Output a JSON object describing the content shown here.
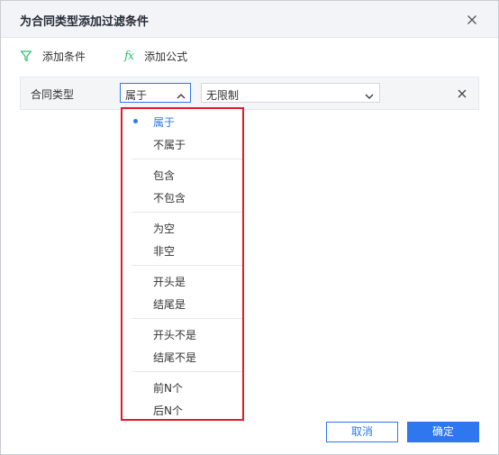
{
  "dialog": {
    "title": "为合同类型添加过滤条件"
  },
  "toolbar": {
    "add_condition": "添加条件",
    "add_formula": "添加公式",
    "formula_icon_text": "fx"
  },
  "condition": {
    "field": "合同类型",
    "operator": "属于",
    "value": "无限制"
  },
  "operator_menu": {
    "groups": [
      [
        "属于",
        "不属于"
      ],
      [
        "包含",
        "不包含"
      ],
      [
        "为空",
        "非空"
      ],
      [
        "开头是",
        "结尾是"
      ],
      [
        "开头不是",
        "结尾不是"
      ],
      [
        "前N个",
        "后N个"
      ]
    ],
    "selected": "属于"
  },
  "footer": {
    "cancel": "取消",
    "ok": "确定"
  },
  "colors": {
    "accent": "#2f77ee",
    "highlight_border": "#e21b2a",
    "formula_icon": "#2dbd6e"
  }
}
